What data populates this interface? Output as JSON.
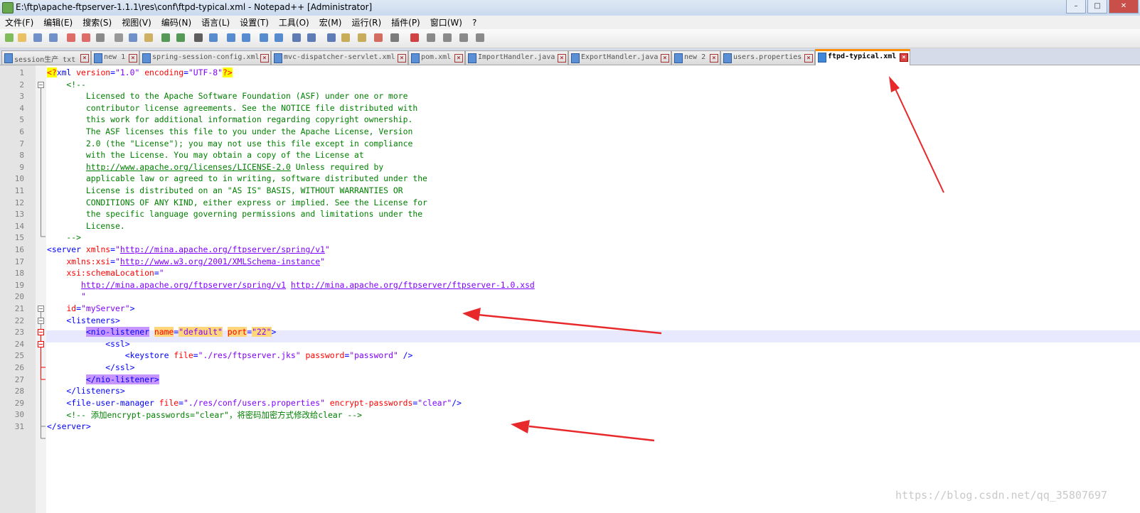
{
  "window": {
    "title": "E:\\ftp\\apache-ftpserver-1.1.1\\res\\conf\\ftpd-typical.xml - Notepad++ [Administrator]",
    "minimize": "–",
    "maximize": "□",
    "close": "✕"
  },
  "menu": [
    "文件(F)",
    "编辑(E)",
    "搜索(S)",
    "视图(V)",
    "编码(N)",
    "语言(L)",
    "设置(T)",
    "工具(O)",
    "宏(M)",
    "运行(R)",
    "插件(P)",
    "窗口(W)",
    "?"
  ],
  "toolbar_icons": [
    "new-file-icon",
    "open-file-icon",
    "save-icon",
    "save-all-icon",
    "close-icon",
    "close-all-icon",
    "print-icon",
    "cut-icon",
    "copy-icon",
    "paste-icon",
    "undo-icon",
    "redo-icon",
    "find-icon",
    "replace-icon",
    "zoom-in-icon",
    "zoom-out-icon",
    "sync-v-icon",
    "sync-h-icon",
    "wrap-icon",
    "all-chars-icon",
    "indent-guide-icon",
    "doc-map-icon",
    "function-list-icon",
    "folder-workspace-icon",
    "monitor-icon",
    "record-macro-icon",
    "stop-macro-icon",
    "play-macro-icon",
    "run-macro-multiple-icon",
    "save-macro-icon"
  ],
  "tabs": [
    {
      "label": "session生产 txt",
      "active": false
    },
    {
      "label": "new 1",
      "active": false
    },
    {
      "label": "spring-session-config.xml",
      "active": false
    },
    {
      "label": "mvc-dispatcher-servlet.xml",
      "active": false
    },
    {
      "label": "pom.xml",
      "active": false
    },
    {
      "label": "ImportHandler.java",
      "active": false
    },
    {
      "label": "ExportHandler.java",
      "active": false
    },
    {
      "label": "new 2",
      "active": false
    },
    {
      "label": "users.properties",
      "active": false
    },
    {
      "label": "ftpd-typical.xml",
      "active": true
    }
  ],
  "editor": {
    "current_line": 23,
    "lines": [
      [
        [
          "<?",
          "pi"
        ],
        [
          "xml ",
          "tag"
        ],
        [
          "version",
          "attr"
        ],
        [
          "=",
          "tag"
        ],
        [
          "\"1.0\"",
          "val"
        ],
        [
          " ",
          "tag"
        ],
        [
          "encoding",
          "attr"
        ],
        [
          "=",
          "tag"
        ],
        [
          "\"UTF-8\"",
          "val"
        ],
        [
          "?>",
          "pi"
        ]
      ],
      [
        [
          "    <!--",
          "com"
        ]
      ],
      [
        [
          "        Licensed to the Apache Software Foundation (ASF) under one or more",
          "com"
        ]
      ],
      [
        [
          "        contributor license agreements. See the NOTICE file distributed with",
          "com"
        ]
      ],
      [
        [
          "        this work for additional information regarding copyright ownership.",
          "com"
        ]
      ],
      [
        [
          "        The ASF licenses this file to you under the Apache License, Version",
          "com"
        ]
      ],
      [
        [
          "        2.0 (the \"License\"); you may not use this file except in compliance",
          "com"
        ]
      ],
      [
        [
          "        with the License. You may obtain a copy of the License at",
          "com"
        ]
      ],
      [
        [
          "        ",
          "com"
        ],
        [
          "http://www.apache.org/licenses/LICENSE-2.0",
          "lnkc"
        ],
        [
          " Unless required by",
          "com"
        ]
      ],
      [
        [
          "        applicable law or agreed to in writing, software distributed under the",
          "com"
        ]
      ],
      [
        [
          "        License is distributed on an \"AS IS\" BASIS, WITHOUT WARRANTIES OR",
          "com"
        ]
      ],
      [
        [
          "        CONDITIONS OF ANY KIND, either express or implied. See the License for",
          "com"
        ]
      ],
      [
        [
          "        the specific language governing permissions and limitations under the",
          "com"
        ]
      ],
      [
        [
          "        License.",
          "com"
        ]
      ],
      [
        [
          "    -->",
          "com"
        ]
      ],
      [
        [
          "<server ",
          "tag"
        ],
        [
          "xmlns",
          "attr"
        ],
        [
          "=",
          "tag"
        ],
        [
          "\"",
          "val"
        ],
        [
          "http://mina.apache.org/ftpserver/spring/v1",
          "lnk"
        ],
        [
          "\"",
          "val"
        ]
      ],
      [
        [
          "    ",
          "tag"
        ],
        [
          "xmlns:xsi",
          "attr"
        ],
        [
          "=",
          "tag"
        ],
        [
          "\"",
          "val"
        ],
        [
          "http://www.w3.org/2001/XMLSchema-instance",
          "lnk"
        ],
        [
          "\"",
          "val"
        ]
      ],
      [
        [
          "    ",
          "tag"
        ],
        [
          "xsi:schemaLocation",
          "attr"
        ],
        [
          "=",
          "tag"
        ],
        [
          "\"",
          "val"
        ]
      ],
      [
        [
          "       ",
          "val"
        ],
        [
          "http://mina.apache.org/ftpserver/spring/v1",
          "lnk"
        ],
        [
          " ",
          "val"
        ],
        [
          "http://mina.apache.org/ftpserver/ftpserver-1.0.xsd",
          "lnk"
        ]
      ],
      [
        [
          "       \"",
          "val"
        ]
      ],
      [
        [
          "    ",
          "tag"
        ],
        [
          "id",
          "attr"
        ],
        [
          "=",
          "tag"
        ],
        [
          "\"myServer\"",
          "val"
        ],
        [
          ">",
          "tag"
        ]
      ],
      [
        [
          "    <listeners>",
          "tag"
        ]
      ],
      [
        [
          "        ",
          "tag"
        ],
        [
          "<nio-listener",
          "mtag"
        ],
        [
          " ",
          "tag"
        ],
        [
          "name",
          "attrhl"
        ],
        [
          "=",
          "tag"
        ],
        [
          "\"default\"",
          "valhl"
        ],
        [
          " ",
          "tag"
        ],
        [
          "port",
          "attrhl"
        ],
        [
          "=",
          "tag"
        ],
        [
          "\"22\"",
          "valhl"
        ],
        [
          ">",
          "tag"
        ]
      ],
      [
        [
          "            <ssl>",
          "tag"
        ]
      ],
      [
        [
          "                <keystore ",
          "tag"
        ],
        [
          "file",
          "attr"
        ],
        [
          "=",
          "tag"
        ],
        [
          "\"./res/ftpserver.jks\"",
          "val"
        ],
        [
          " ",
          "tag"
        ],
        [
          "password",
          "attr"
        ],
        [
          "=",
          "tag"
        ],
        [
          "\"password\"",
          "val"
        ],
        [
          " />",
          "tag"
        ]
      ],
      [
        [
          "            </ssl>",
          "tag"
        ]
      ],
      [
        [
          "        ",
          "tag"
        ],
        [
          "</nio-listener>",
          "mtag"
        ]
      ],
      [
        [
          "    </listeners>",
          "tag"
        ]
      ],
      [
        [
          "    <file-user-manager ",
          "tag"
        ],
        [
          "file",
          "attr"
        ],
        [
          "=",
          "tag"
        ],
        [
          "\"./res/conf/users.properties\"",
          "val"
        ],
        [
          " ",
          "tag"
        ],
        [
          "encrypt-passwords",
          "attr"
        ],
        [
          "=",
          "tag"
        ],
        [
          "\"clear\"",
          "val"
        ],
        [
          "/>",
          "tag"
        ]
      ],
      [
        [
          "    <!-- 添加encrypt-passwords=\"clear\"，将密码加密方式修改给clear -->",
          "com"
        ]
      ],
      [
        [
          "</server>",
          "tag"
        ]
      ]
    ],
    "fold_markers": {
      "2": "black",
      "21": "black",
      "22": "black",
      "23": "red",
      "24": "red"
    }
  },
  "watermark": "https://blog.csdn.net/qq_35807697",
  "arrow_color": "#e8292b"
}
